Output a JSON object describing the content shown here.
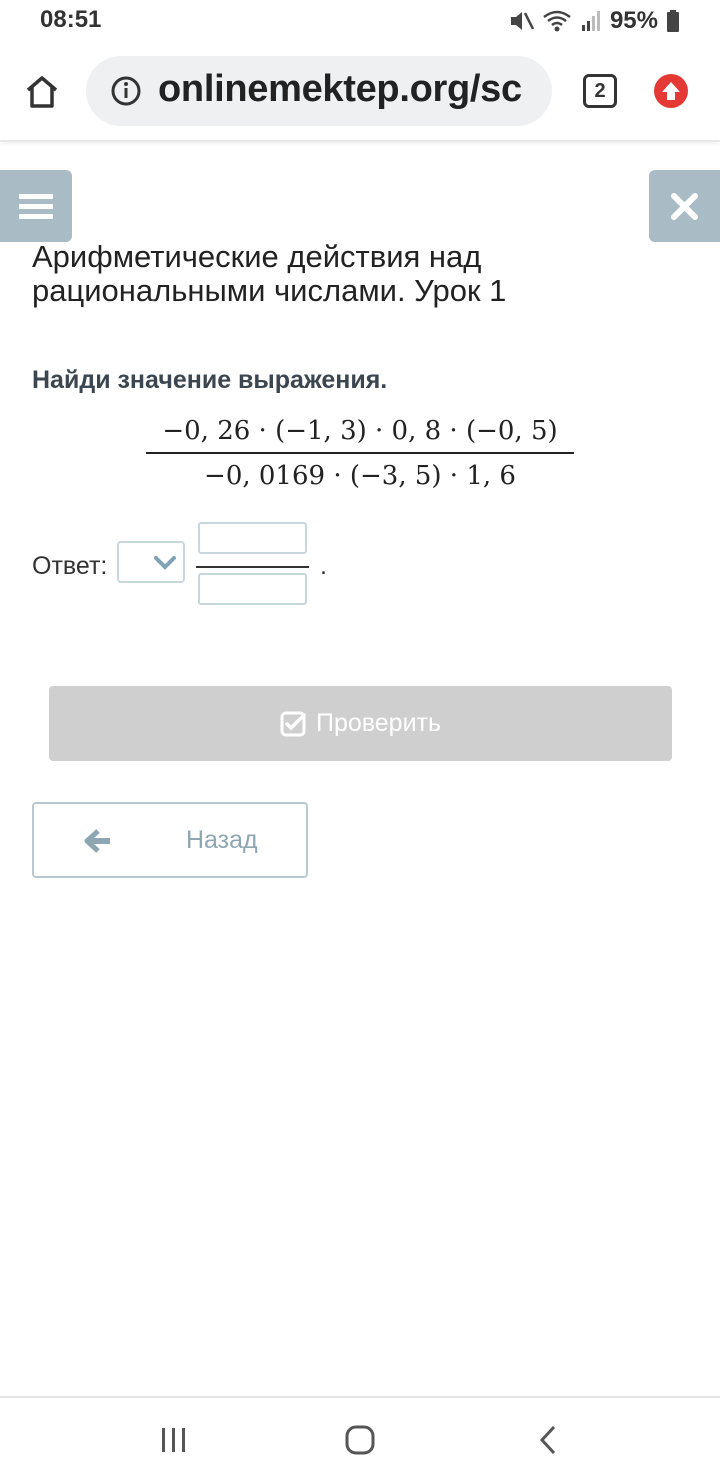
{
  "status_bar": {
    "time": "08:51",
    "battery": "95%",
    "icons": [
      "mute-icon",
      "wifi-icon",
      "signal-icon",
      "battery-icon"
    ]
  },
  "browser": {
    "url": "onlinemektep.org/sc",
    "tab_count": "2",
    "icons": [
      "home-icon",
      "info-icon",
      "update-icon"
    ],
    "update_color": "#e53935"
  },
  "page": {
    "title": "Арифметические действия над рациональными числами. Урок 1",
    "task": "Найди значение выражения.",
    "expression": {
      "numerator": "−0, 26  ·  (−1, 3)  ·  0, 8  ·  (−0, 5)",
      "denominator": "−0, 0169  ·  (−3, 5)  ·  1, 6"
    },
    "answer_label": "Ответ:",
    "answer_period": ".",
    "answer": {
      "sign": "",
      "numerator": "",
      "denominator": ""
    },
    "check_button": "Проверить",
    "back_button": "Назад",
    "accent_color": "#a9bcc6",
    "button_disabled_color": "#cfcfcf"
  },
  "nav_bar": {
    "icons": [
      "recents-icon",
      "home-circle-icon",
      "back-icon"
    ]
  }
}
